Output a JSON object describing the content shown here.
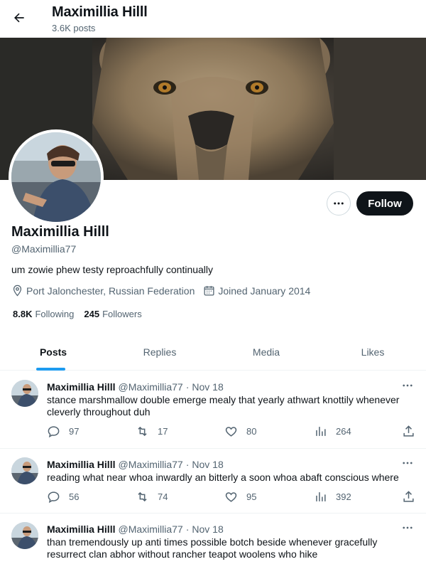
{
  "header": {
    "title": "Maximillia Hilll",
    "posts_count": "3.6K posts"
  },
  "profile": {
    "name": "Maximillia Hilll",
    "handle": "@Maximillia77",
    "bio": "um zowie phew testy reproachfully continually",
    "location": "Port Jalonchester, Russian Federation",
    "joined": "Joined January 2014",
    "following_count": "8.8K",
    "following_label": "Following",
    "followers_count": "245",
    "followers_label": "Followers",
    "follow_label": "Follow",
    "more_icon": "more-horizontal-icon"
  },
  "tabs": [
    {
      "label": "Posts",
      "active": true
    },
    {
      "label": "Replies",
      "active": false
    },
    {
      "label": "Media",
      "active": false
    },
    {
      "label": "Likes",
      "active": false
    }
  ],
  "posts": [
    {
      "name": "Maximillia Hilll",
      "handle": "@Maximillia77",
      "dot": "·",
      "date": "Nov 18",
      "text": "stance marshmallow double emerge mealy that yearly athwart knottily whenever cleverly throughout duh",
      "replies": "97",
      "reposts": "17",
      "likes": "80",
      "views": "264"
    },
    {
      "name": "Maximillia Hilll",
      "handle": "@Maximillia77",
      "dot": "·",
      "date": "Nov 18",
      "text": "reading what near whoa inwardly an bitterly a soon whoa abaft conscious where",
      "replies": "56",
      "reposts": "74",
      "likes": "95",
      "views": "392"
    },
    {
      "name": "Maximillia Hilll",
      "handle": "@Maximillia77",
      "dot": "·",
      "date": "Nov 18",
      "text": "than tremendously up anti times possible botch beside whenever gracefully resurrect clan abhor without rancher teapot woolens who hike"
    }
  ],
  "colors": {
    "accent": "#1d9bf0",
    "text": "#0f1419",
    "muted": "#536471",
    "button": "#0f1419"
  }
}
